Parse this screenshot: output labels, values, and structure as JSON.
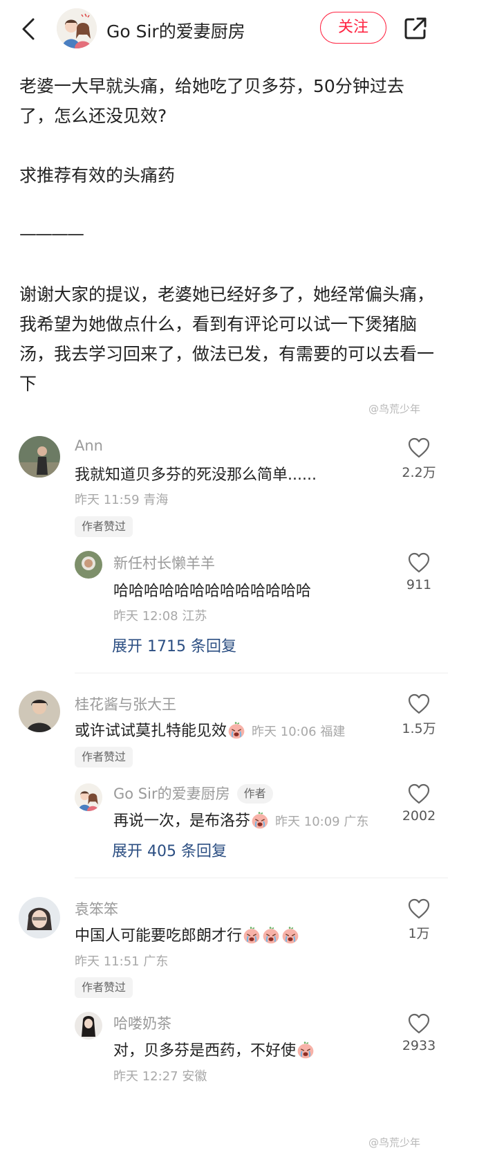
{
  "header": {
    "account_name": "Go Sir的爱妻厨房",
    "follow_label": "关注"
  },
  "post": {
    "paragraph1": "老婆一大早就头痛，给她吃了贝多芬，50分钟过去了，怎么还没见效?",
    "paragraph2": "求推荐有效的头痛药",
    "divider": "————",
    "paragraph3": "谢谢大家的提议，老婆她已经好多了，她经常偏头痛，我希望为她做点什么，看到有评论可以试一下煲猪脑汤，我去学习回来了，做法已发，有需要的可以去看一下"
  },
  "watermark": "@鸟荒少年",
  "comments": [
    {
      "name": "Ann",
      "text": "我就知道贝多芬的死没那么简单......",
      "meta": "昨天 11:59 青海",
      "likes": "2.2万",
      "tag": "作者赞过",
      "reply": {
        "name": "新任村长懒羊羊",
        "text": "哈哈哈哈哈哈哈哈哈哈哈哈哈",
        "meta": "昨天 12:08 江苏",
        "likes": "911"
      },
      "expand": "展开 1715 条回复"
    },
    {
      "name": "桂花酱与张大王",
      "text": "或许试试莫扎特能见效",
      "meta": "昨天 10:06 福建",
      "likes": "1.5万",
      "tag": "作者赞过",
      "reply": {
        "name": "Go Sir的爱妻厨房",
        "badge": "作者",
        "text": "再说一次，是布洛芬",
        "meta": "昨天 10:09 广东",
        "likes": "2002"
      },
      "expand": "展开 405 条回复"
    },
    {
      "name": "袁笨笨",
      "text": "中国人可能要吃郎朗才行",
      "meta": "昨天 11:51 广东",
      "likes": "1万",
      "tag": "作者赞过",
      "reply": {
        "name": "哈喽奶茶",
        "text": "对，贝多芬是西药，不好使",
        "meta": "昨天 12:27 安徽",
        "likes": "2933"
      }
    }
  ],
  "colors": {
    "accent": "#ff2442",
    "link": "#2b4e82",
    "muted": "#a8a8a8"
  },
  "icons": [
    "back-arrow-icon",
    "share-icon",
    "heart-icon",
    "crying-emoji-icon"
  ]
}
